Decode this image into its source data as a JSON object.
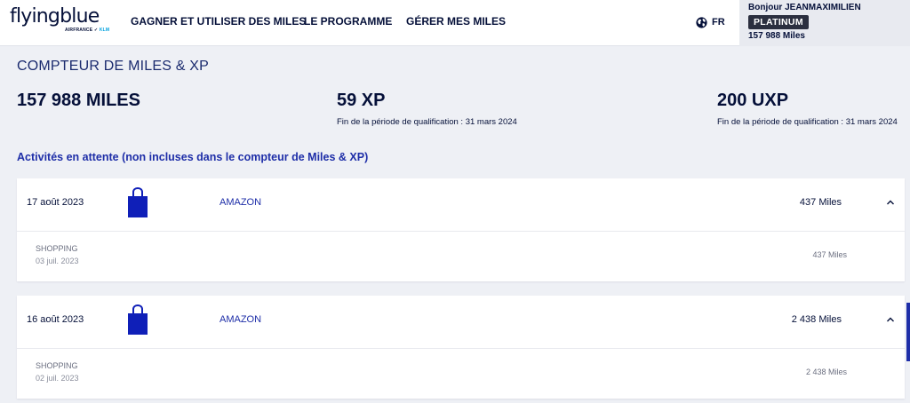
{
  "header": {
    "logo": {
      "text": "flyingblue",
      "sub_airline": "AIRFRANCE ✓",
      "sub_klm": "KLM"
    },
    "nav": [
      {
        "label": "GAGNER ET UTILISER DES MILES"
      },
      {
        "label": "LE PROGRAMME"
      },
      {
        "label": "GÉRER MES MILES"
      }
    ],
    "language": "FR",
    "user": {
      "greeting": "Bonjour JEANMAXIMILIEN",
      "tier": "PLATINUM",
      "miles": "157 988 Miles"
    }
  },
  "counter": {
    "title": "COMPTEUR DE MILES & XP",
    "miles": "157 988 MILES",
    "xp": "59 XP",
    "xp_note": "Fin de la période de qualification : 31 mars 2024",
    "uxp": "200 UXP",
    "uxp_note": "Fin de la période de qualification : 31 mars 2024"
  },
  "pending": {
    "title": "Activités en attente (non incluses dans le compteur de Miles & XP)",
    "activities": [
      {
        "date": "17 août 2023",
        "merchant": "AMAZON",
        "miles": "437 Miles",
        "category": "SHOPPING",
        "sub_date": "03 juil. 2023",
        "sub_miles": "437 Miles"
      },
      {
        "date": "16 août 2023",
        "merchant": "AMAZON",
        "miles": "2 438 Miles",
        "category": "SHOPPING",
        "sub_date": "02 juil. 2023",
        "sub_miles": "2 438 Miles"
      }
    ]
  },
  "icons": {
    "globe": "globe-icon",
    "bag": "shopping-bag-icon",
    "chevron": "chevron-up-icon"
  },
  "colors": {
    "brand_navy": "#051039",
    "accent_blue": "#1e2ea8",
    "bag_blue": "#0f1fb8",
    "tier_badge": "#2b2f3f",
    "background": "#eef0f5"
  }
}
